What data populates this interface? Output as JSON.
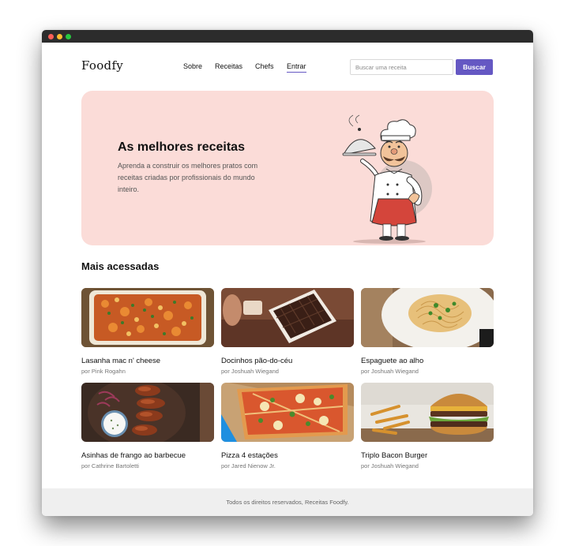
{
  "header": {
    "logo": "Foodfy",
    "nav": [
      {
        "label": "Sobre"
      },
      {
        "label": "Receitas"
      },
      {
        "label": "Chefs"
      },
      {
        "label": "Entrar"
      }
    ],
    "search": {
      "placeholder": "Buscar uma receita",
      "value": "",
      "button_label": "Buscar"
    }
  },
  "hero": {
    "title": "As melhores receitas",
    "text": "Aprenda a construir os melhores pratos com receitas criadas por profissionais do mundo inteiro."
  },
  "section": {
    "title": "Mais acessadas"
  },
  "recipes": [
    {
      "name": "Lasanha mac n' cheese",
      "author": "por Pink Rogahn"
    },
    {
      "name": "Docinhos pão-do-céu",
      "author": "por Joshuah Wiegand"
    },
    {
      "name": "Espaguete ao alho",
      "author": "por Joshuah Wiegand"
    },
    {
      "name": "Asinhas de frango ao barbecue",
      "author": "por Cathrine Bartoletti"
    },
    {
      "name": "Pizza 4 estações",
      "author": "por Jared Nienow Jr."
    },
    {
      "name": "Triplo Bacon Burger",
      "author": "por Joshuah Wiegand"
    }
  ],
  "footer": {
    "text": "Todos os direitos reservados, Receitas Foodfy."
  },
  "colors": {
    "accent": "#6558c3",
    "hero_background": "#fbdcd8",
    "footer_background": "#efefef"
  }
}
